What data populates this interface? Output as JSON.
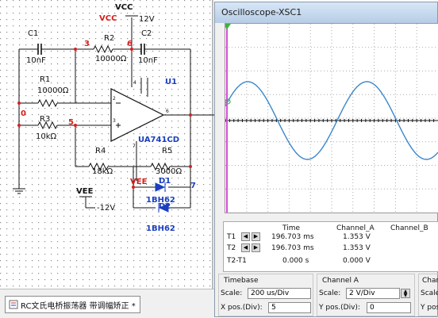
{
  "schematic": {
    "vcc_top": "VCC",
    "vcc_red": "VCC",
    "v12": "12V",
    "c1": "C1",
    "c1_val": "10nF",
    "r2": "R2",
    "r2_val": "10000Ω",
    "c2": "C2",
    "c2_val": "10nF",
    "node3": "3",
    "node6": "6",
    "r1": "R1",
    "r1_val": "10000Ω",
    "node0": "0",
    "r3": "R3",
    "r3_val": "10kΩ",
    "node5": "5",
    "u1": "U1",
    "opamp": "UA741CD",
    "r4": "R4",
    "r4_val": "18kΩ",
    "r5": "R5",
    "r5_val": "3000Ω",
    "vee_red": "VEE",
    "node7": "7",
    "d1": "D1",
    "d1_part": "1BH62",
    "d2": "D2",
    "d2_part": "1BH62",
    "vee": "VEE",
    "vneg12": "-12V",
    "pin_marks": [
      "4",
      "2",
      "3",
      "6",
      "7"
    ]
  },
  "tab": {
    "label": "RC文氏电桥振荡器 带调幅矫正 *"
  },
  "scope": {
    "title": "Oscilloscope-XSC1",
    "trace_color": "#3d87c8",
    "readout": {
      "headers": [
        "Time",
        "Channel_A",
        "Channel_B"
      ],
      "rows": [
        {
          "label": "T1",
          "time": "196.703 ms",
          "cha": "1.353 V",
          "chb": ""
        },
        {
          "label": "T2",
          "time": "196.703 ms",
          "cha": "1.353 V",
          "chb": ""
        },
        {
          "label": "T2-T1",
          "time": "0.000 s",
          "cha": "0.000 V",
          "chb": ""
        }
      ]
    },
    "timebase": {
      "title": "Timebase",
      "scale_label": "Scale:",
      "scale": "200 us/Div",
      "xpos_label": "X pos.(Div):",
      "xpos": "5"
    },
    "channel_a": {
      "title": "Channel A",
      "scale_label": "Scale:",
      "scale": "2  V/Div",
      "ypos_label": "Y pos.(Div):",
      "ypos": "0"
    },
    "channel_b": {
      "title": "Chan",
      "scale_label": "Scale:",
      "ypos_label": "Y pos."
    }
  }
}
